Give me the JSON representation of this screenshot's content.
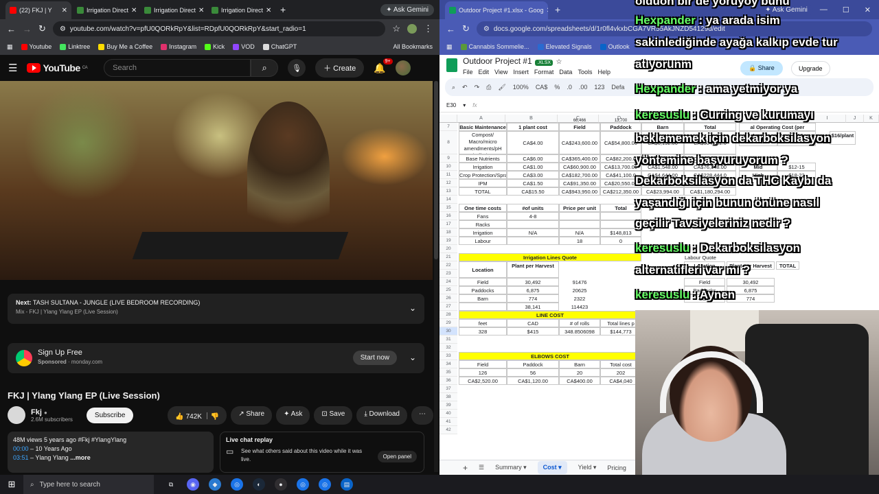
{
  "left_browser": {
    "tabs": [
      {
        "label": "(22) FKJ | Y",
        "active": true
      },
      {
        "label": "Irrigation Direct"
      },
      {
        "label": "Irrigation Direct"
      },
      {
        "label": "Irrigation Direct"
      }
    ],
    "ask_gemini": "Ask Gemini",
    "url": "youtube.com/watch?v=pfU0QORkRpY&list=RDpfU0QORkRpY&start_radio=1",
    "bookmarks": [
      "Youtube",
      "Linktree",
      "Buy Me a Coffee",
      "Instagram",
      "Kick",
      "VOD",
      "ChatGPT"
    ],
    "all_bookmarks": "All Bookmarks"
  },
  "youtube": {
    "logo": "YouTube",
    "country": "CA",
    "search_placeholder": "Search",
    "create_label": "Create",
    "notif_count": "9+",
    "up_next": {
      "prefix": "Next:",
      "title": "TASH SULTANA - JUNGLE (LIVE BEDROOM RECORDING)",
      "sub": "Mix - FKJ  |  Ylang Ylang EP (Live Session)"
    },
    "ad": {
      "title": "Sign Up Free",
      "sponsored": "Sponsored",
      "domain": "monday.com",
      "cta": "Start now"
    },
    "video_title": "FKJ | Ylang Ylang EP (Live Session)",
    "channel": {
      "name": "Fkj",
      "subs": "2.6M subscribers",
      "subscribe": "Subscribe"
    },
    "actions": {
      "likes": "742K",
      "share": "Share",
      "ask": "Ask",
      "save": "Save",
      "download": "Download"
    },
    "description": {
      "stats": "48M views  5 years ago  #Fkj #YlangYlang",
      "line1_ts": "00:00",
      "line1": "– 10 Years Ago",
      "line2_ts": "03:51",
      "line2": "– Ylang Ylang",
      "more": "...more"
    },
    "live_chat": {
      "title": "Live chat replay",
      "text": "See what others said about this video while it was live.",
      "open": "Open panel"
    }
  },
  "right_browser": {
    "tab": "Outdoor Project #1.xlsx - Goog",
    "ask_gemini": "Ask Gemini",
    "url": "docs.google.com/spreadsheets/d/1r0fl4vkxbCGA7VR55AkJNZD54129d/edit",
    "bookmarks": [
      "Cannabis Sommelie...",
      "Elevated Signals",
      "Outlook"
    ]
  },
  "sheets": {
    "title": "Outdoor Project #1",
    "badge": ".XLSX",
    "menus": [
      "File",
      "Edit",
      "View",
      "Insert",
      "Format",
      "Data",
      "Tools",
      "Help"
    ],
    "share": "Share",
    "upgrade": "Upgrade",
    "cell_ref": "E30",
    "zoom": "100%",
    "currency": "CA$",
    "font": "Defa",
    "sheet_tabs": [
      "Summary",
      "Cost",
      "Yield",
      "Pricing"
    ],
    "active_tab": "Cost",
    "columns": [
      "A",
      "B",
      "C",
      "D",
      "E",
      "F",
      "G",
      "H",
      "I",
      "J",
      "K"
    ],
    "rows": [
      "7",
      "8",
      "9",
      "10",
      "11",
      "12",
      "13",
      "14",
      "15",
      "16",
      "17",
      "18",
      "19",
      "20",
      "21",
      "22",
      "23",
      "24",
      "25",
      "26",
      "27",
      "28",
      "29",
      "30",
      "31",
      "32",
      "33",
      "34",
      "35",
      "36",
      "37",
      "38",
      "39",
      "40",
      "41",
      "42"
    ],
    "top_partial": {
      "c": "66,466",
      "d": "13,700"
    },
    "maintenance_header": [
      "Basic Maintenance",
      "1 plant cost",
      "Field",
      "Paddock",
      "Barn",
      "Total"
    ],
    "maintenance": [
      [
        "Compost/ Macro/micro amendments/pH buffering",
        "CA$4.00",
        "CA$243,600.00",
        "CA$54,800.00",
        "CA$6,192.00",
        "CA$304,592.0"
      ],
      [
        "Base Nutrients",
        "CA$6.00",
        "CA$365,400.00",
        "CA$82,200.0",
        "CA$9,288.00",
        "CA$456,888.0"
      ],
      [
        "Irrigation",
        "CA$1.00",
        "CA$60,900.00",
        "CA$13,700.00",
        "CA$1,548.00",
        "CA$76,148.00"
      ],
      [
        "Crop Protection/Sprays",
        "CA$3.00",
        "CA$182,700.00",
        "CA$41,100.0",
        "CA$4,644.00",
        "CA$228,444.0"
      ],
      [
        "IPM",
        "CA$1.50",
        "CA$91,350.00",
        "CA$20,550.00",
        "CA$2,322.00",
        "CA$114,222.0"
      ],
      [
        "TOTAL",
        "CA$15.50",
        "CA$943,950.00",
        "CA$212,350.00",
        "CA$23,994.00",
        "CA$1,180,294.00"
      ]
    ],
    "op_cost": {
      "header": "al Operating Cost (per",
      "rows": [
        [
          "Low",
          "$8-10"
        ],
        [
          "Mid",
          "$12-15"
        ],
        [
          "High",
          "$18-22"
        ]
      ],
      "aside": "$16/plant"
    },
    "one_time_header": [
      "One time costs",
      "#of units",
      "Price per unit",
      "Total"
    ],
    "one_time": [
      [
        "Fans",
        "4-8",
        "",
        ""
      ],
      [
        "Racks",
        "",
        "",
        ""
      ],
      [
        "Irrigation",
        "N/A",
        "N/A",
        "$148,813"
      ],
      [
        "Labour",
        "",
        "18",
        "0"
      ]
    ],
    "irrigation_quote": "Irrigation Lines Quote",
    "location_header": [
      "Location",
      "Plant per Harvest"
    ],
    "locations": [
      [
        "Field",
        "30,492",
        "91476"
      ],
      [
        "Paddocks",
        "6,875",
        "20625"
      ],
      [
        "Barn",
        "774",
        "2322"
      ],
      [
        "",
        "38,141",
        "114423"
      ]
    ],
    "labour_quote": "Labour Quote",
    "labour_header": [
      "Location",
      "Plant per Harvest",
      "TOTAL"
    ],
    "labour_rows": [
      [
        "Field",
        "30,492"
      ],
      [
        "Paddocks",
        "6,875"
      ],
      [
        "Barn",
        "774"
      ]
    ],
    "line_cost": {
      "title": "LINE COST",
      "header": [
        "feet",
        "CAD",
        "# of rolls",
        "Total lines p"
      ],
      "row": [
        "328",
        "$415",
        "348.8506098",
        "$144,773"
      ]
    },
    "elbows_cost": {
      "title": "ELBOWS COST",
      "header": [
        "Field",
        "Paddock",
        "Barn",
        "Total cost"
      ],
      "row1": [
        "126",
        "56",
        "20",
        "202"
      ],
      "row2": [
        "CA$2,520.00",
        "CA$1,120.00",
        "CA$400.00",
        "CA$4,040"
      ]
    }
  },
  "chat_overlay": [
    {
      "user": "",
      "text": "olduon bir de yoruyoy bunu"
    },
    {
      "user": "Hexpander",
      "text": ": ya arada isim"
    },
    {
      "user": "",
      "text": "sakinlediğinde ayağa kalkıp evde tur"
    },
    {
      "user": "",
      "text": "atıyorunm"
    },
    {
      "user": "Hexpander",
      "text": ": ama yetmiyor ya"
    },
    {
      "user": "keresuslu",
      "text": ": Curring ve kurumayı"
    },
    {
      "user": "",
      "text": "beklememek için dekarboksilasyon"
    },
    {
      "user": "",
      "text": "yöntemine başvuruyorum ?"
    },
    {
      "user": "",
      "text": "Dekarboksilasyon da THC Kaybı da"
    },
    {
      "user": "",
      "text": "yaşandığı için bunun önüne nasıl"
    },
    {
      "user": "",
      "text": "geçilir Tavsiyeleriniz nedir ?"
    },
    {
      "user": "keresuslu",
      "text": ": Dekarboksilasyon"
    },
    {
      "user": "",
      "text": "alternatifleri var mı ?"
    },
    {
      "user": "keresuslu",
      "text": ": Aynen"
    }
  ],
  "taskbar": {
    "search_placeholder": "Type here to search"
  }
}
